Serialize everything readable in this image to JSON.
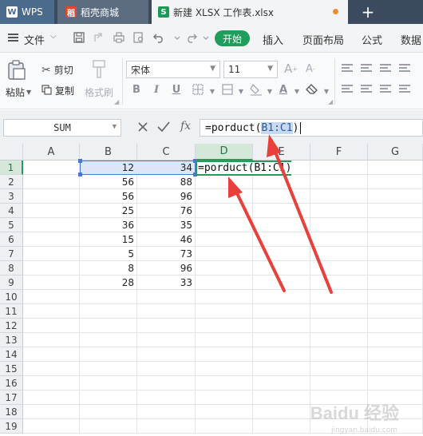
{
  "tabs": {
    "wps": "WPS",
    "store": "稻壳商城",
    "doc": "新建 XLSX 工作表.xlsx",
    "add": "+"
  },
  "menu": {
    "file": "文件",
    "start": "开始",
    "insert": "插入",
    "page_layout": "页面布局",
    "formula": "公式",
    "data": "数据"
  },
  "ribbon": {
    "paste": "粘贴",
    "cut": "剪切",
    "copy": "复制",
    "format_painter": "格式刷",
    "font_name": "宋体",
    "font_size": "11"
  },
  "formula_bar": {
    "name_box": "SUM",
    "fx": "fx",
    "formula_prefix": "=porduct(",
    "formula_ref": "B1:C1",
    "formula_suffix": ")"
  },
  "sheet": {
    "columns": [
      "A",
      "B",
      "C",
      "D",
      "E",
      "F",
      "G"
    ],
    "active_column": "D",
    "active_row": 1,
    "rows": [
      "1",
      "2",
      "3",
      "4",
      "5",
      "6",
      "7",
      "8",
      "9",
      "10",
      "11",
      "12",
      "13",
      "14",
      "15",
      "16",
      "17",
      "18",
      "19"
    ],
    "data": [
      {
        "B": "12",
        "C": "34"
      },
      {
        "B": "56",
        "C": "88"
      },
      {
        "B": "56",
        "C": "96"
      },
      {
        "B": "25",
        "C": "76"
      },
      {
        "B": "36",
        "C": "35"
      },
      {
        "B": "15",
        "C": "46"
      },
      {
        "B": "5",
        "C": "73"
      },
      {
        "B": "8",
        "C": "96"
      },
      {
        "B": "28",
        "C": "33"
      }
    ],
    "editing_cell": {
      "prefix": "=porduct(",
      "ref": "B1:C1",
      "suffix": ")"
    }
  },
  "colors": {
    "accent_green": "#1e9e5a",
    "arrow_red": "#e8403a",
    "ref_blue": "#4a7ac0"
  },
  "watermark": {
    "brand": "Baidu 经验",
    "sub": "jingyan.baidu.com"
  }
}
